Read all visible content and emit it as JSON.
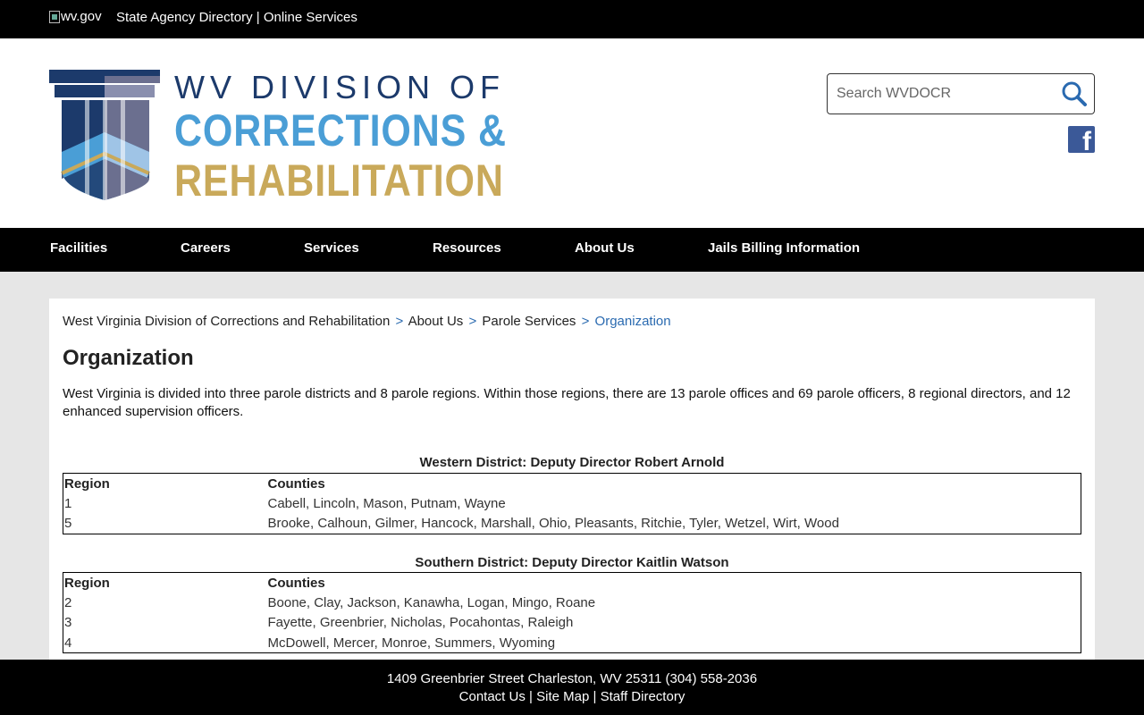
{
  "topbar": {
    "wvgov_alt": "wv.gov",
    "agency_directory": "State Agency Directory",
    "separator": "|",
    "online_services": "Online Services"
  },
  "logo": {
    "line1": "WV DIVISION OF",
    "line2": "CORRECTIONS &",
    "line3": "REHABILITATION",
    "colors": {
      "navy": "#1c3a6b",
      "blue": "#4a9ed6",
      "gold": "#c9a95a"
    }
  },
  "search": {
    "placeholder": "Search WVDOCR",
    "icon": "search-icon"
  },
  "social": {
    "facebook_icon": "facebook-icon",
    "glyph": "f"
  },
  "nav": {
    "items": [
      {
        "label": "Facilities"
      },
      {
        "label": "Careers"
      },
      {
        "label": "Services"
      },
      {
        "label": "Resources"
      },
      {
        "label": "About Us"
      },
      {
        "label": "Jails Billing Information"
      }
    ]
  },
  "breadcrumb": {
    "items": [
      "West Virginia Division of Corrections and Rehabilitation",
      "About Us",
      "Parole Services"
    ],
    "current": "Organization",
    "separator": ">"
  },
  "page": {
    "title": "Organization",
    "intro": "West Virginia is divided into three parole districts and 8 parole regions. Within those regions, there are 13 parole offices and 69 parole officers, 8 regional directors, and 12 enhanced supervision officers."
  },
  "districts": [
    {
      "title": "Western District: Deputy Director Robert Arnold",
      "headers": [
        "Region",
        "Counties"
      ],
      "rows": [
        [
          "1",
          "Cabell, Lincoln, Mason, Putnam, Wayne"
        ],
        [
          "5",
          "Brooke, Calhoun, Gilmer, Hancock, Marshall, Ohio, Pleasants, Ritchie, Tyler, Wetzel, Wirt, Wood"
        ]
      ]
    },
    {
      "title": "Southern District: Deputy Director Kaitlin Watson",
      "headers": [
        "Region",
        "Counties"
      ],
      "rows": [
        [
          "2",
          "Boone, Clay, Jackson, Kanawha, Logan, Mingo, Roane"
        ],
        [
          "3",
          "Fayette, Greenbrier, Nicholas, Pocahontas, Raleigh"
        ],
        [
          "4",
          "McDowell, Mercer, Monroe, Summers, Wyoming"
        ]
      ]
    }
  ],
  "footer": {
    "address": "1409 Greenbrier Street Charleston, WV 25311 (304) 558-2036",
    "contact": "Contact Us",
    "sitemap": "Site Map",
    "staff": "Staff Directory",
    "separator": "|"
  }
}
